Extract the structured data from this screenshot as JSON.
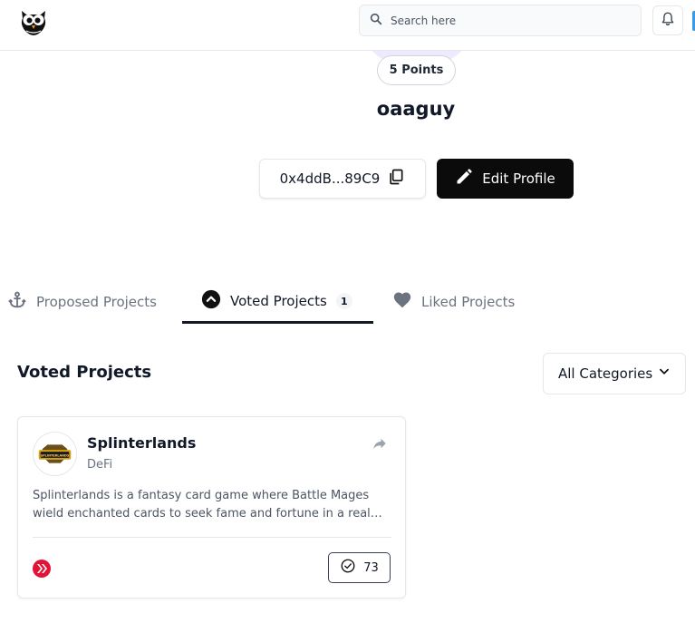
{
  "header": {
    "search_placeholder": "Search here",
    "icons": [
      "owl-logo-icon",
      "search-icon",
      "bell-icon"
    ]
  },
  "profile": {
    "points_label": "5 Points",
    "username": "oaaguy",
    "wallet_address": "0x4ddB...89C9",
    "edit_label": "Edit Profile"
  },
  "tabs": [
    {
      "label": "Proposed Projects",
      "icon": "anchor-icon",
      "active": false
    },
    {
      "label": "Voted Projects",
      "icon": "chevron-up-circle-icon",
      "count": "1",
      "active": true
    },
    {
      "label": "Liked Projects",
      "icon": "heart-icon",
      "active": false
    }
  ],
  "section": {
    "title": "Voted Projects",
    "category_filter": "All Categories"
  },
  "projects": [
    {
      "name": "Splinterlands",
      "category": "DeFi",
      "description": "Splinterlands is a fantasy card game where Battle Mages wield enchanted cards to seek fame and fortune in a realm of magic and mayhem.",
      "votes": "73",
      "logo_text": "SPLINTERLANDS"
    }
  ],
  "colors": {
    "primary_button": "#0b0b0b",
    "active_tab_underline": "#111827",
    "hive_red": "#e31337",
    "avatar_tint": "#ede9fe"
  }
}
